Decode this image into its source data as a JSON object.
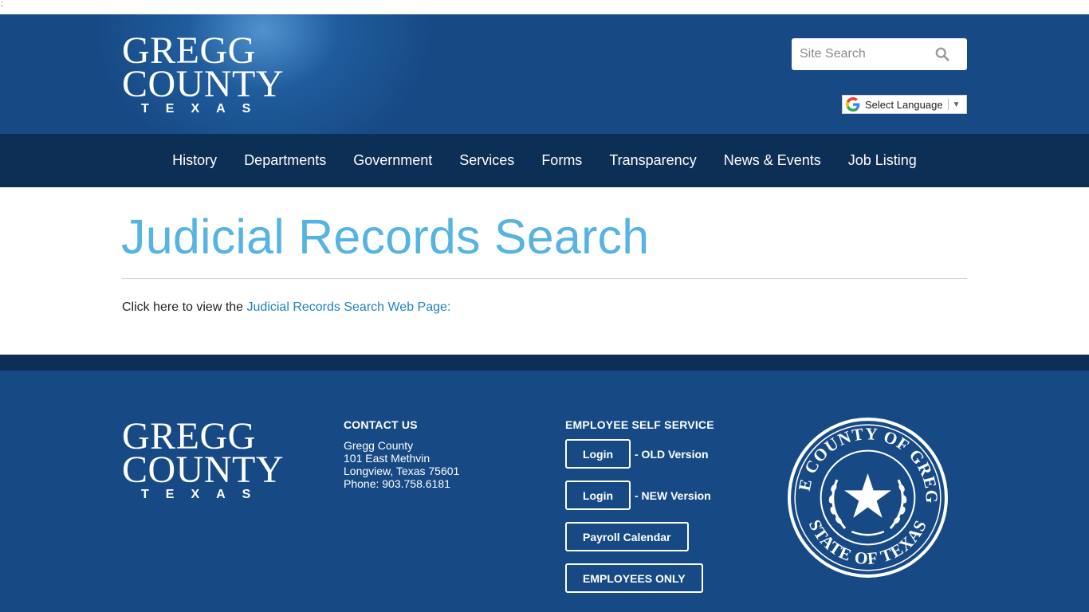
{
  "top_mark": ";",
  "header": {
    "logo": {
      "line1": "GREGG",
      "line2": "COUNTY",
      "line3": "TEXAS"
    },
    "search": {
      "placeholder": "Site Search",
      "icon": "search-icon"
    },
    "language": {
      "label": "Select Language",
      "icon": "google-icon",
      "arrow": "▼"
    }
  },
  "nav": {
    "items": [
      {
        "label": "History"
      },
      {
        "label": "Departments"
      },
      {
        "label": "Government"
      },
      {
        "label": "Services"
      },
      {
        "label": "Forms"
      },
      {
        "label": "Transparency"
      },
      {
        "label": "News & Events"
      },
      {
        "label": "Job Listing"
      }
    ]
  },
  "main": {
    "title": "Judicial Records Search",
    "intro_text": "Click here to view the ",
    "link_text": "Judicial Records Search Web Page:"
  },
  "footer": {
    "logo": {
      "line1": "GREGG",
      "line2": "COUNTY",
      "line3": "TEXAS"
    },
    "contact": {
      "heading": "CONTACT US",
      "name": "Gregg County",
      "street": "101 East Methvin",
      "city": "Longview, Texas 75601",
      "phone": "Phone: 903.758.6181"
    },
    "ess": {
      "heading": "EMPLOYEE SELF SERVICE",
      "login_old": {
        "label": "Login",
        "suffix": "- OLD Version"
      },
      "login_new": {
        "label": "Login",
        "suffix": "- NEW Version"
      },
      "payroll": "Payroll Calendar",
      "employees_only": "EMPLOYEES ONLY"
    },
    "seal": {
      "outer_top": "THE COUNTY OF GREGG",
      "outer_bottom": "STATE OF TEXAS"
    }
  },
  "colors": {
    "header_blue": "#174a85",
    "nav_dark": "#0d2e55",
    "title_blue": "#55b4e2",
    "link_blue": "#1e82c0"
  }
}
